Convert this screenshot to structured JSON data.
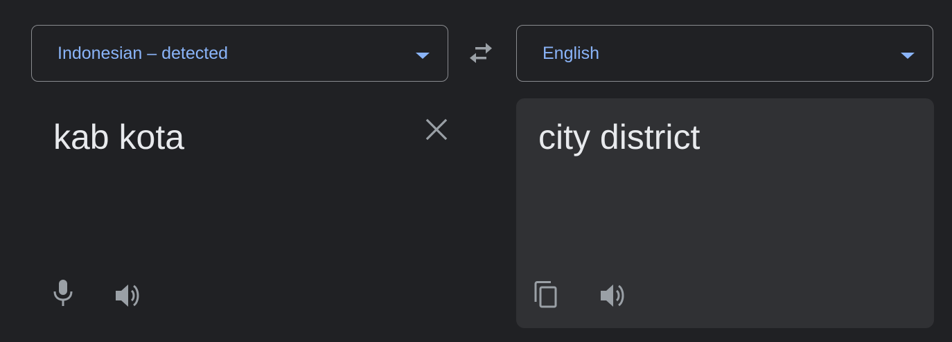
{
  "source": {
    "language_label": "Indonesian – detected",
    "text": "kab kota"
  },
  "target": {
    "language_label": "English",
    "text": "city district"
  },
  "icons": {
    "swap": "swap-languages-icon",
    "clear": "close-icon",
    "mic": "microphone-icon",
    "speaker": "speaker-icon",
    "copy": "copy-icon"
  },
  "colors": {
    "background": "#202124",
    "target_pane": "#303134",
    "accent": "#8ab4f8",
    "text": "#e8eaed",
    "icon": "#9aa0a6"
  }
}
